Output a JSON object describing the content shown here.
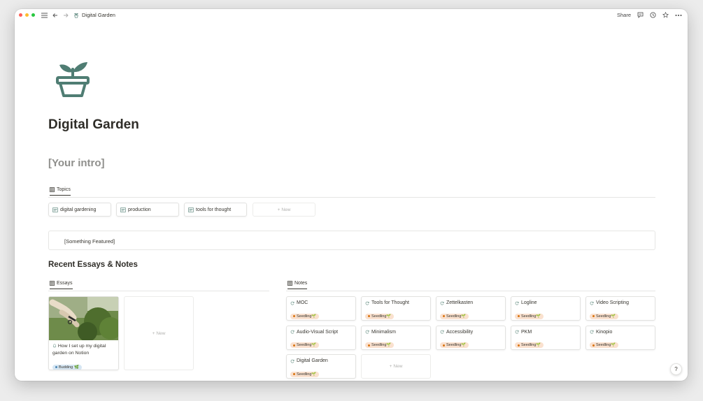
{
  "breadcrumb": {
    "page": "Digital Garden"
  },
  "toolbar": {
    "share_label": "Share"
  },
  "page": {
    "title": "Digital Garden",
    "intro": "[Your intro]",
    "icon": "plant-pot-icon",
    "icon_color": "#4f7d73"
  },
  "topics": {
    "view_label": "Topics",
    "items": [
      {
        "label": "digital gardening"
      },
      {
        "label": "production"
      },
      {
        "label": "tools for thought"
      }
    ],
    "new_label": "New"
  },
  "featured": {
    "text": "[Something Featured]"
  },
  "recent": {
    "title": "Recent Essays & Notes",
    "essays": {
      "view_label": "Essays",
      "items": [
        {
          "title": "How I set up my digital garden on Notion",
          "status": "Budding",
          "status_emoji": "🌿"
        }
      ],
      "new_label": "New"
    },
    "notes": {
      "view_label": "Notes",
      "items": [
        {
          "title": "MOC",
          "status": "Seedling🌱"
        },
        {
          "title": "Tools for Thought",
          "status": "Seedling🌱"
        },
        {
          "title": "Zettelkasten",
          "status": "Seedling🌱"
        },
        {
          "title": "Logline",
          "status": "Seedling🌱"
        },
        {
          "title": "Video Scripting",
          "status": "Seedling🌱"
        },
        {
          "title": "Audio-Visual Script",
          "status": "Seedling🌱"
        },
        {
          "title": "Minimalism",
          "status": "Seedling🌱"
        },
        {
          "title": "Accessibility",
          "status": "Seedling🌱"
        },
        {
          "title": "PKM",
          "status": "Seedling🌱"
        },
        {
          "title": "Kinopio",
          "status": "Seedling🌱"
        },
        {
          "title": "Digital Garden",
          "status": "Seedling🌱"
        }
      ],
      "new_label": "New"
    }
  },
  "help": {
    "label": "?"
  },
  "colors": {
    "seedling_badge": "#fae1cf",
    "budding_badge": "#d6e6f3",
    "text": "#37352f"
  }
}
